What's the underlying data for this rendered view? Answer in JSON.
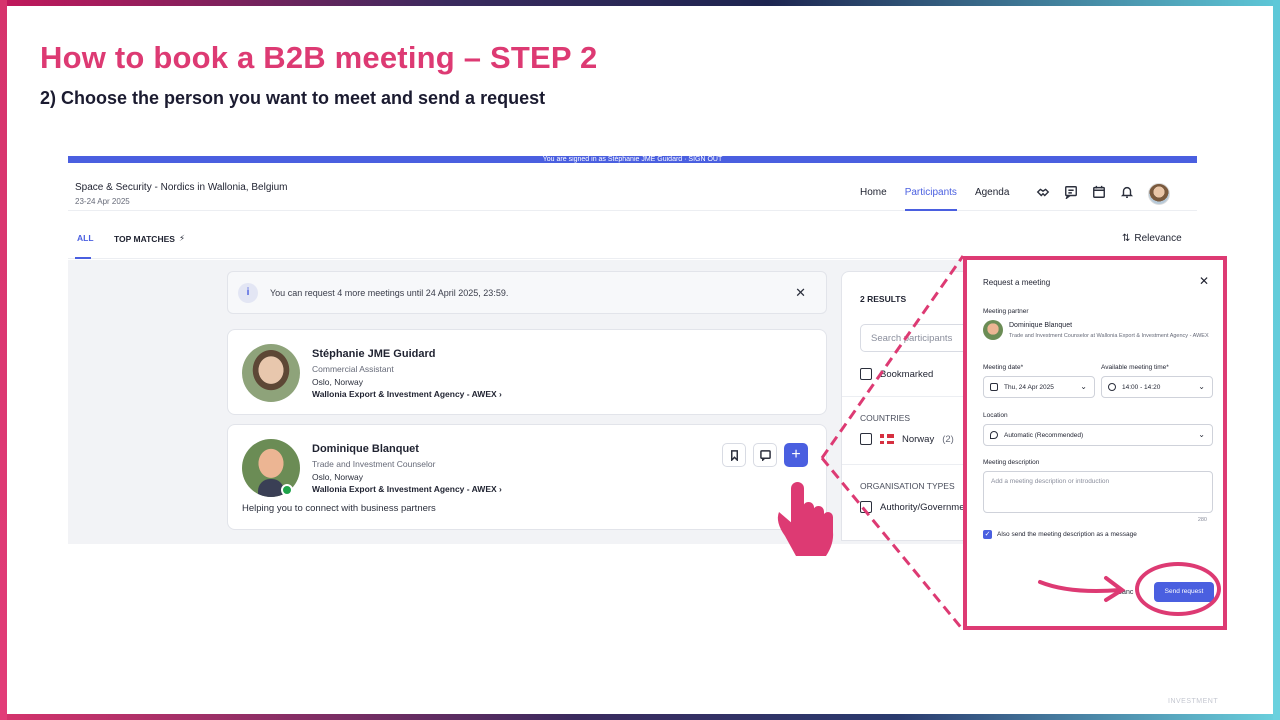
{
  "slide": {
    "title": "How to book a B2B  meeting – STEP 2",
    "subtitle": "2) Choose the person you want to meet and send a request",
    "footer_mark": "INVESTMENT"
  },
  "app": {
    "topbar_text": "You are signed in as Stéphanie JME Guidard · SIGN OUT",
    "event_title": "Space & Security - Nordics in Wallonia, Belgium",
    "event_date": "23-24 Apr 2025",
    "nav": [
      "Home",
      "Participants",
      "Agenda"
    ],
    "nav_active_index": 1,
    "tabs": {
      "all": "ALL",
      "top_matches": "TOP MATCHES"
    },
    "sort_label": "Relevance",
    "info_text": "You can request 4 more meetings until 24 April 2025, 23:59.",
    "participants": [
      {
        "name": "Stéphanie JME Guidard",
        "role": "Commercial Assistant",
        "location": "Oslo, Norway",
        "org": "Wallonia Export & Investment Agency - AWEX"
      },
      {
        "name": "Dominique Blanquet",
        "role": "Trade and Investment Counselor",
        "location": "Oslo, Norway",
        "org": "Wallonia Export & Investment Agency - AWEX",
        "bio": "Helping you to connect with business partners"
      }
    ],
    "side": {
      "results": "2 RESULTS",
      "search_placeholder": "Search participants",
      "bookmarked": "Bookmarked",
      "countries_label": "COUNTRIES",
      "country": "Norway",
      "country_count": "(2)",
      "org_types_label": "ORGANISATION TYPES",
      "org_type": "Authority/Governmer"
    }
  },
  "modal": {
    "title": "Request a meeting",
    "partner_label": "Meeting partner",
    "partner_name": "Dominique Blanquet",
    "partner_role": "Trade and Investment Counselor at Wallonia Export & Investment Agency - AWEX",
    "date_label": "Meeting date*",
    "date_value": "Thu, 24 Apr 2025",
    "time_label": "Available meeting time*",
    "time_value": "14:00 - 14:20",
    "location_label": "Location",
    "location_value": "Automatic (Recommended)",
    "desc_label": "Meeting description",
    "desc_placeholder": "Add a meeting description or introduction",
    "desc_count": "280",
    "checkbox_label": "Also send the meeting description as a message",
    "cancel_label": "Canc",
    "send_label": "Send request"
  },
  "colors": {
    "accent_pink": "#dd3a73",
    "app_blue": "#4a5fe0"
  }
}
